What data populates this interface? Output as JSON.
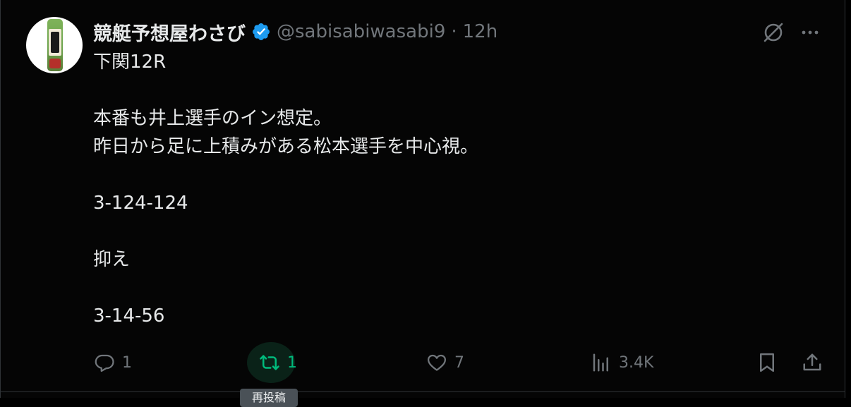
{
  "post": {
    "display_name": "競艇予想屋わさび",
    "handle": "@sabisabiwasabi9",
    "separator": "·",
    "time": "12h",
    "text_lines": [
      "下関12R",
      "",
      "本番も井上選手のイン想定。",
      "昨日から足に上積みがある松本選手を中心視。",
      "",
      "3-124-124",
      "",
      "抑え",
      "",
      "3-14-56"
    ]
  },
  "actions": {
    "reply": {
      "icon": "reply-icon",
      "count": "1"
    },
    "retweet": {
      "icon": "retweet-icon",
      "count": "1",
      "tooltip": "再投稿"
    },
    "like": {
      "icon": "heart-icon",
      "count": "7"
    },
    "views": {
      "icon": "views-chart-icon",
      "count": "3.4K"
    },
    "bookmark": {
      "icon": "bookmark-icon"
    },
    "share": {
      "icon": "share-icon"
    }
  },
  "icons": {
    "verified": "verified-badge-icon",
    "grok": "grok-icon",
    "more": "more-icon"
  },
  "colors": {
    "background": "#000000",
    "text": "#e7e9ea",
    "muted": "#71767b",
    "verified": "#1d9bf0",
    "retweet_active": "#00ba7c"
  }
}
